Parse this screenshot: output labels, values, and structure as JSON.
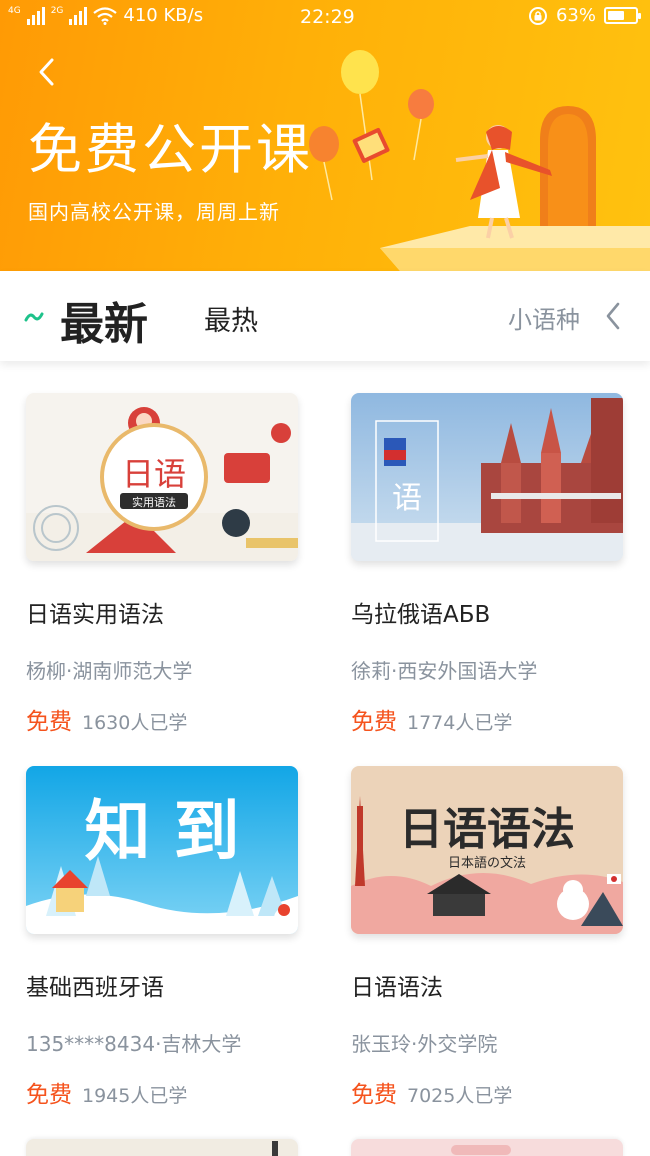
{
  "status_bar": {
    "net_top": "4G",
    "net_bottom": "2G",
    "speed": "410 KB/s",
    "time": "22:29",
    "battery": "63%",
    "battery_level": 0.63
  },
  "header": {
    "title": "免费公开课",
    "subtitle": "国内高校公开课，周周上新"
  },
  "tabs": {
    "newest": "最新",
    "hot": "最热",
    "minor_language": "小语种"
  },
  "courses": [
    {
      "title": "日语实用语法",
      "teacher": "杨柳·湖南师范大学",
      "price": "免费",
      "learners": "1630人已学",
      "thumb_main": "日语",
      "thumb_sub": "实用语法"
    },
    {
      "title": "乌拉俄语АБВ",
      "teacher": "徐莉·西安外国语大学",
      "price": "免费",
      "learners": "1774人已学",
      "thumb_main": "语"
    },
    {
      "title": "基础西班牙语",
      "teacher": "135****8434·吉林大学",
      "price": "免费",
      "learners": "1945人已学",
      "thumb_main": "知 到"
    },
    {
      "title": "日语语法",
      "teacher": "张玉玲·外交学院",
      "price": "免费",
      "learners": "7025人已学",
      "thumb_main": "日语语法",
      "thumb_sub": "日本語の文法"
    }
  ],
  "colors": {
    "banner_start": "#ff9a05",
    "banner_end": "#ffc20f",
    "price": "#f5531d",
    "tab_accent": "#1ec28b"
  }
}
